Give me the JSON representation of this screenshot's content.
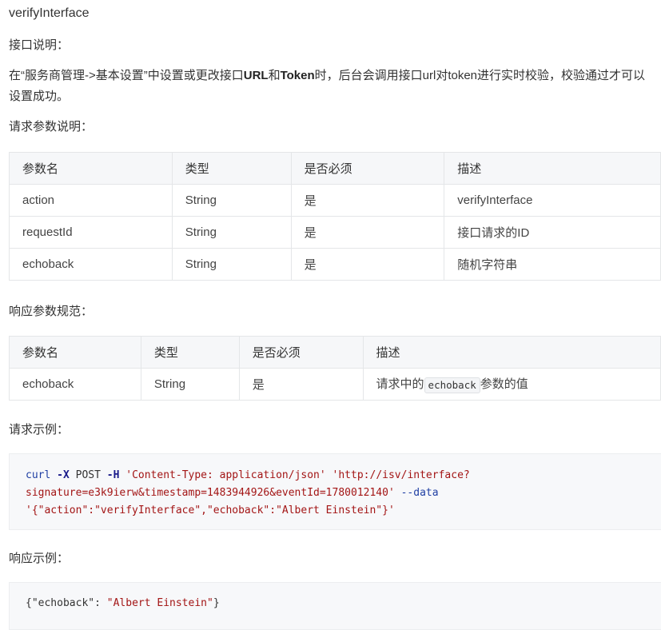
{
  "title": "verifyInterface",
  "label_api_desc": "接口说明：",
  "desc": {
    "p1": "在“服务商管理->基本设置”中设置或更改接口",
    "b1": "URL",
    "p2": "和",
    "b2": "Token",
    "p3": "时，后台会调用接口url对token进行实时校验，校验通过才可以设置成功。"
  },
  "label_request_params": "请求参数说明：",
  "request_table": {
    "headers": [
      "参数名",
      "类型",
      "是否必须",
      "描述"
    ],
    "rows": [
      [
        "action",
        "String",
        "是",
        "verifyInterface"
      ],
      [
        "requestId",
        "String",
        "是",
        "接口请求的ID"
      ],
      [
        "echoback",
        "String",
        "是",
        "随机字符串"
      ]
    ]
  },
  "label_response_params": "响应参数规范：",
  "response_table": {
    "headers": [
      "参数名",
      "类型",
      "是否必须",
      "描述"
    ],
    "row": {
      "name": "echoback",
      "type": "String",
      "required": "是",
      "desc_prefix": "请求中的",
      "desc_code": "echoback",
      "desc_suffix": "参数的值"
    }
  },
  "label_request_example": "请求示例：",
  "request_code": {
    "cmd": "curl",
    "flag_x": "-X",
    "method": "POST",
    "flag_h": "-H",
    "header_str": "'Content-Type: application/json'",
    "url_part1": "'http://isv/interface?",
    "url_part2": "signature=e3k9ierw&timestamp=1483944926&eventId=1780012140'",
    "flag_data": "--data",
    "body_str": "'{\"action\":\"verifyInterface\",\"echoback\":\"Albert Einstein\"}'"
  },
  "label_response_example": "响应示例：",
  "response_code": {
    "open": "{",
    "key": "\"echoback\"",
    "colon": ": ",
    "value": "\"Albert Einstein\"",
    "close": "}"
  }
}
